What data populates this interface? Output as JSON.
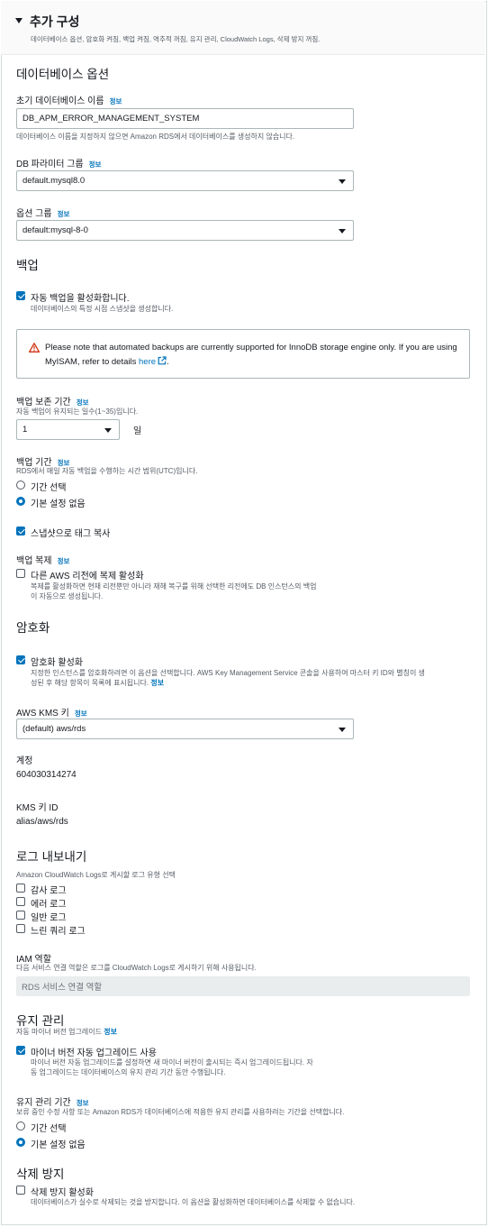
{
  "header": {
    "title": "추가 구성",
    "subtitle": "데이터베이스 옵션, 암호화 켜짐, 백업 켜짐, 역추적 꺼짐, 유지 관리, CloudWatch Logs, 삭제 방지 꺼짐."
  },
  "db_options": {
    "section_title": "데이터베이스 옵션",
    "initial_db_name": {
      "label": "초기 데이터베이스 이름",
      "info": "정보",
      "value": "DB_APM_ERROR_MANAGEMENT_SYSTEM",
      "help": "데이터베이스 이름을 지정하지 않으면 Amazon RDS에서 데이터베이스를 생성하지 않습니다."
    },
    "param_group": {
      "label": "DB 파라미터 그룹",
      "info": "정보",
      "value": "default.mysql8.0"
    },
    "option_group": {
      "label": "옵션 그룹",
      "info": "정보",
      "value": "default:mysql-8-0"
    }
  },
  "backup": {
    "section_title": "백업",
    "auto_backup": {
      "label": "자동 백업을 활성화합니다.",
      "desc": "데이터베이스의 특정 시점 스냅샷을 생성합니다.",
      "checked": true
    },
    "alert": {
      "text": "Please note that automated backups are currently supported for InnoDB storage engine only. If you are using MyISAM, refer to details",
      "link": "here",
      "suffix": "."
    },
    "retention": {
      "label": "백업 보존 기간",
      "info": "정보",
      "desc": "자동 백업이 유지되는 일수(1~35)입니다.",
      "value": "1",
      "unit": "일"
    },
    "window": {
      "label": "백업 기간",
      "info": "정보",
      "desc": "RDS에서 매일 자동 백업을 수행하는 시간 범위(UTC)입니다.",
      "options": [
        "기간 선택",
        "기본 설정 없음"
      ],
      "selected_index": 1
    },
    "copy_tags": {
      "label": "스냅샷으로 태그 복사",
      "checked": true
    },
    "replication": {
      "label": "백업 복제",
      "info": "정보",
      "cb_label": "다른 AWS 리전에 복제 활성화",
      "desc1": "복제를 활성화하면 현재 리전뿐만 아니라 재해 복구를 위해 선택한 리전에도 DB 인스턴스의 백업",
      "desc2": "이 자동으로 생성됩니다.",
      "checked": false
    }
  },
  "encryption": {
    "section_title": "암호화",
    "enable": {
      "label": "암호화 활성화",
      "desc1": "지정한 인스턴스를 암호화하려면 이 옵션을 선택합니다. AWS Key Management Service 콘솔을 사용하여 마스터 키 ID와 별칭이 생",
      "desc2": "성된 후 해당 항목이 목록에 표시됩니다.",
      "desc_info": "정보",
      "checked": true
    },
    "kms_key": {
      "label": "AWS KMS 키",
      "info": "정보",
      "value": "(default) aws/rds"
    },
    "account": {
      "label": "계정",
      "value": "604030314274"
    },
    "kms_key_id": {
      "label": "KMS 키 ID",
      "value": "alias/aws/rds"
    }
  },
  "logs": {
    "section_title": "로그 내보내기",
    "desc": "Amazon CloudWatch Logs로 게시할 로그 유형 선택",
    "items": [
      {
        "label": "감사 로그",
        "checked": false
      },
      {
        "label": "에러 로그",
        "checked": false
      },
      {
        "label": "일반 로그",
        "checked": false
      },
      {
        "label": "느린 쿼리 로그",
        "checked": false
      }
    ],
    "iam_role": {
      "label": "IAM 역할",
      "desc": "다음 서비스 연결 역할은 로그를 CloudWatch Logs로 게시하기 위해 사용됩니다.",
      "value": "RDS 서비스 연결 역할"
    }
  },
  "maintenance": {
    "section_title": "유지 관리",
    "auto_upgrade_title": "자동 마이너 버전 업그레이드",
    "info": "정보",
    "auto_upgrade": {
      "label": "마이너 버전 자동 업그레이드 사용",
      "desc1": "마이너 버전 자동 업그레이드를 설정하면 새 마이너 버전이 출시되는 즉시 업그레이드됩니다. 자",
      "desc2": "동 업그레이드는 데이터베이스의 유지 관리 기간 동안 수행됩니다.",
      "checked": true
    },
    "window": {
      "label": "유지 관리 기간",
      "info": "정보",
      "desc": "보류 중인 수정 사항 또는 Amazon RDS가 데이터베이스에 적용한 유지 관리를 사용하려는 기간을 선택합니다.",
      "options": [
        "기간 선택",
        "기본 설정 없음"
      ],
      "selected_index": 1
    }
  },
  "deletion": {
    "section_title": "삭제 방지",
    "label": "삭제 방지 활성화",
    "desc": "데이터베이스가 실수로 삭제되는 것을 방지합니다. 이 옵션을 활성화하면 데이터베이스를 삭제할 수 없습니다.",
    "checked": false
  }
}
